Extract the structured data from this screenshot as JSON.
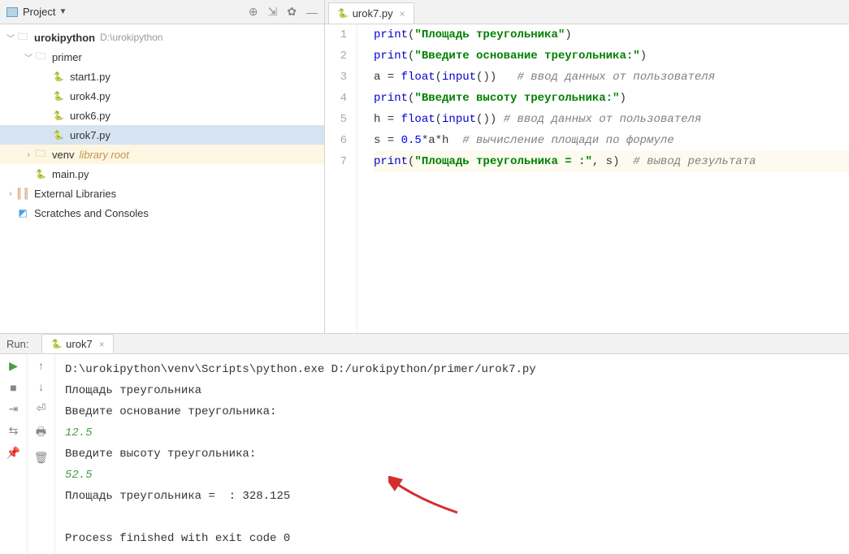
{
  "project": {
    "title": "Project",
    "root": {
      "name": "urokipython",
      "path": "D:\\urokipython"
    },
    "primer": "primer",
    "files": [
      "start1.py",
      "urok4.py",
      "urok6.py",
      "urok7.py"
    ],
    "venv": "venv",
    "venv_note": "library root",
    "main": "main.py",
    "external": "External Libraries",
    "scratches": "Scratches and Consoles"
  },
  "editor": {
    "tab": "urok7.py",
    "lines": [
      "1",
      "2",
      "3",
      "4",
      "5",
      "6",
      "7"
    ],
    "code": {
      "l1_fn": "print",
      "l1_str": "\"Площадь треугольника\"",
      "l2_fn": "print",
      "l2_str": "\"Введите основание треугольника:\"",
      "l3_a": "a = ",
      "l3_fl": "float",
      "l3_in": "input",
      "l3_p": "())",
      "l3_c": "   # ввод данных от пользователя",
      "l4_fn": "print",
      "l4_str": "\"Введите высоту треугольника:\"",
      "l5_h": "h = ",
      "l5_fl": "float",
      "l5_in": "input",
      "l5_p": "()) ",
      "l5_c": "# ввод данных от пользователя",
      "l6_s": "s = ",
      "l6_n": "0.5",
      "l6_r": "*a*h  ",
      "l6_c": "# вычисление площади по формуле",
      "l7_fn": "print",
      "l7_str": "\"Площадь треугольника = :\"",
      "l7_r": ", s)  ",
      "l7_c": "# вывод результата"
    }
  },
  "run": {
    "label": "Run:",
    "tab": "urok7",
    "lines": {
      "cmd": "D:\\urokipython\\venv\\Scripts\\python.exe D:/urokipython/primer/urok7.py",
      "o1": "Площадь треугольника",
      "o2": "Введите основание треугольника:",
      "i1": "12.5",
      "o3": "Введите высоту треугольника:",
      "i2": "52.5",
      "o4": "Площадь треугольника =  : 328.125",
      "fin": "Process finished with exit code 0"
    }
  }
}
